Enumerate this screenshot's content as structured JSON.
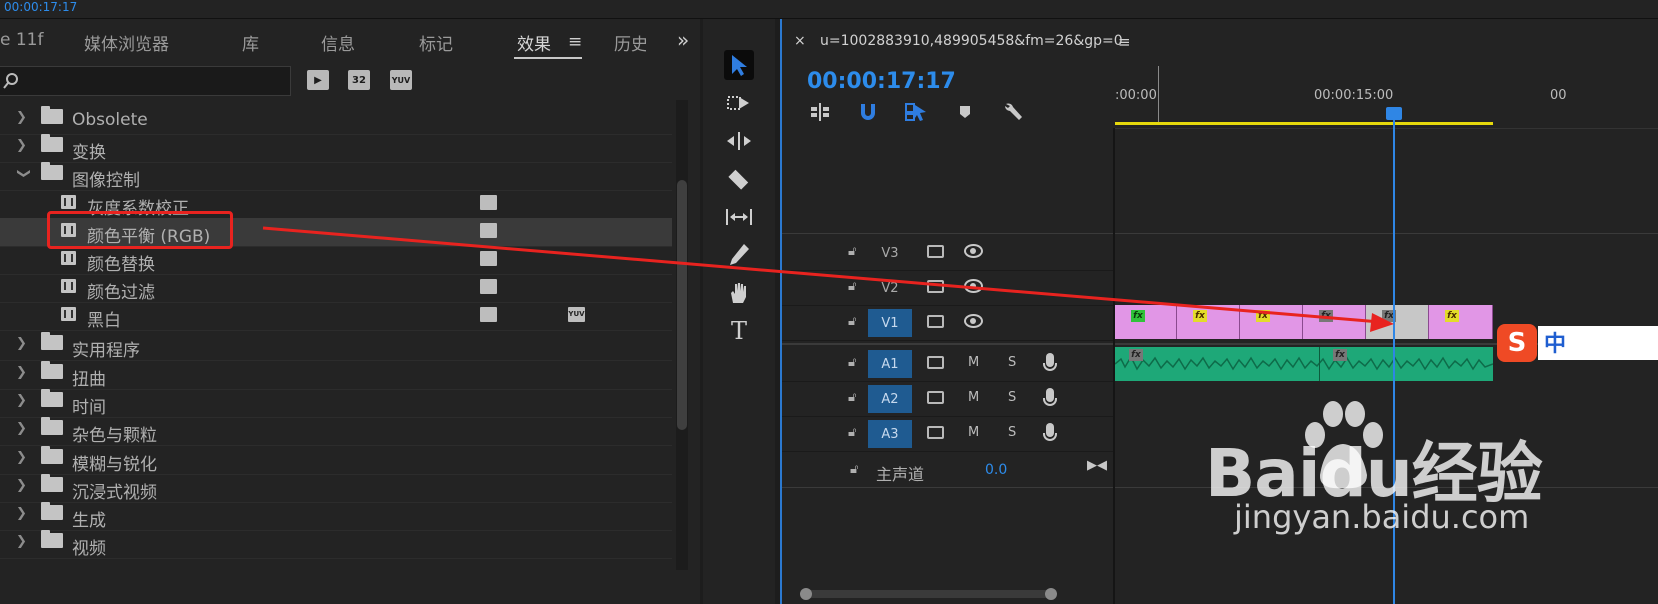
{
  "top": {
    "timecode": "00:00:17:17"
  },
  "effects_panel": {
    "tabs": [
      {
        "label": "e 11f",
        "active": false
      },
      {
        "label": "媒体浏览器",
        "active": false
      },
      {
        "label": "库",
        "active": false
      },
      {
        "label": "信息",
        "active": false
      },
      {
        "label": "标记",
        "active": false
      },
      {
        "label": "效果",
        "active": true
      },
      {
        "label": "历史",
        "active": false
      }
    ],
    "menu_symbol": "≡",
    "overflow_symbol": "»",
    "search": {
      "value": "",
      "placeholder": ""
    },
    "filter_badges": [
      "▶",
      "32",
      "YUV"
    ],
    "tree": [
      {
        "label": "Obsolete",
        "type": "folder",
        "expanded": false
      },
      {
        "label": "变换",
        "type": "folder",
        "expanded": false
      },
      {
        "label": "图像控制",
        "type": "folder",
        "expanded": true
      },
      {
        "label": "灰度系数校正",
        "type": "effect",
        "accelerated": true,
        "yuv": false
      },
      {
        "label": "颜色平衡 (RGB)",
        "type": "effect",
        "accelerated": true,
        "yuv": false,
        "selected": true
      },
      {
        "label": "颜色替换",
        "type": "effect",
        "accelerated": true,
        "yuv": false
      },
      {
        "label": "颜色过滤",
        "type": "effect",
        "accelerated": true,
        "yuv": false
      },
      {
        "label": "黑白",
        "type": "effect",
        "accelerated": true,
        "yuv": true
      },
      {
        "label": "实用程序",
        "type": "folder",
        "expanded": false
      },
      {
        "label": "扭曲",
        "type": "folder",
        "expanded": false
      },
      {
        "label": "时间",
        "type": "folder",
        "expanded": false
      },
      {
        "label": "杂色与颗粒",
        "type": "folder",
        "expanded": false
      },
      {
        "label": "模糊与锐化",
        "type": "folder",
        "expanded": false
      },
      {
        "label": "沉浸式视频",
        "type": "folder",
        "expanded": false
      },
      {
        "label": "生成",
        "type": "folder",
        "expanded": false
      },
      {
        "label": "视频",
        "type": "folder",
        "expanded": false
      }
    ],
    "yuv_label": "YUV"
  },
  "timeline": {
    "sequence_name": "u=1002883910,489905458&fm=26&gp=0",
    "close_symbol": "×",
    "menu_symbol": "≡",
    "playhead_timecode": "00:00:17:17",
    "ruler_labels": [
      ":00:00",
      "00:00:15:00",
      "00"
    ],
    "tracks": [
      {
        "name": "V3",
        "kind": "video",
        "targeted": false
      },
      {
        "name": "V2",
        "kind": "video",
        "targeted": false
      },
      {
        "name": "V1",
        "kind": "video",
        "targeted": true
      },
      {
        "name": "A1",
        "kind": "audio",
        "targeted": true,
        "mute": "M",
        "solo": "S"
      },
      {
        "name": "A2",
        "kind": "audio",
        "targeted": true,
        "mute": "M",
        "solo": "S"
      },
      {
        "name": "A3",
        "kind": "audio",
        "targeted": true,
        "mute": "M",
        "solo": "S"
      }
    ],
    "master": {
      "label": "主声道",
      "value": "0.0"
    },
    "fx_label": "fx"
  },
  "overlay": {
    "ime_logo": "S",
    "ime_text": "中",
    "watermark_main": "Baidu经验",
    "watermark_sub": "jingyan.baidu.com"
  },
  "colors": {
    "accent": "#2d8ceb",
    "highlight": "#e8231f",
    "clip": "#e196e6",
    "audio": "#1ea878",
    "workarea": "#e6d90c"
  }
}
